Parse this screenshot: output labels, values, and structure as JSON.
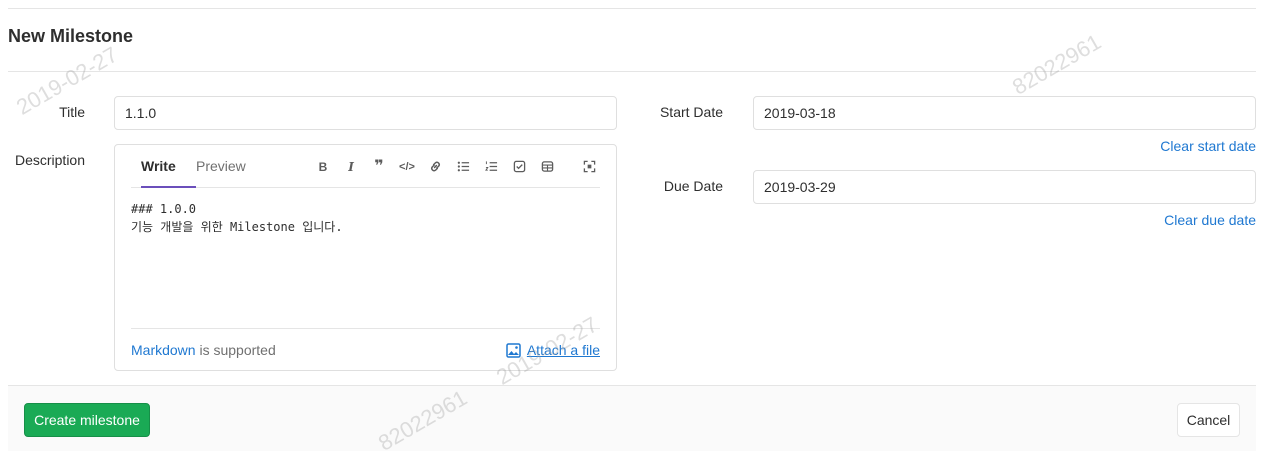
{
  "page": {
    "title": "New Milestone"
  },
  "form": {
    "title_label": "Title",
    "title_value": "1.1.0",
    "description_label": "Description",
    "start_date_label": "Start Date",
    "start_date_value": "2019-03-18",
    "clear_start_label": "Clear start date",
    "due_date_label": "Due Date",
    "due_date_value": "2019-03-29",
    "clear_due_label": "Clear due date"
  },
  "editor": {
    "tabs": {
      "write": "Write",
      "preview": "Preview"
    },
    "toolbar": [
      "bold-icon",
      "italic-icon",
      "quote-icon",
      "code-icon",
      "link-icon",
      "bullet-list-icon",
      "numbered-list-icon",
      "task-list-icon",
      "table-icon",
      "fullscreen-icon"
    ],
    "text": "### 1.0.0\n기능 개발을 위한 Milestone 입니다.",
    "markdown_link": "Markdown",
    "markdown_suffix": " is supported",
    "attach_label": "Attach a file"
  },
  "actions": {
    "create_label": "Create milestone",
    "cancel_label": "Cancel"
  },
  "watermarks": [
    "2019-02-27",
    "82022961",
    "2019-02-27",
    "82022961"
  ],
  "colors": {
    "primary_link": "#1f78d1",
    "create_button": "#1aaa55",
    "active_tab_underline": "#6b4fbb"
  }
}
